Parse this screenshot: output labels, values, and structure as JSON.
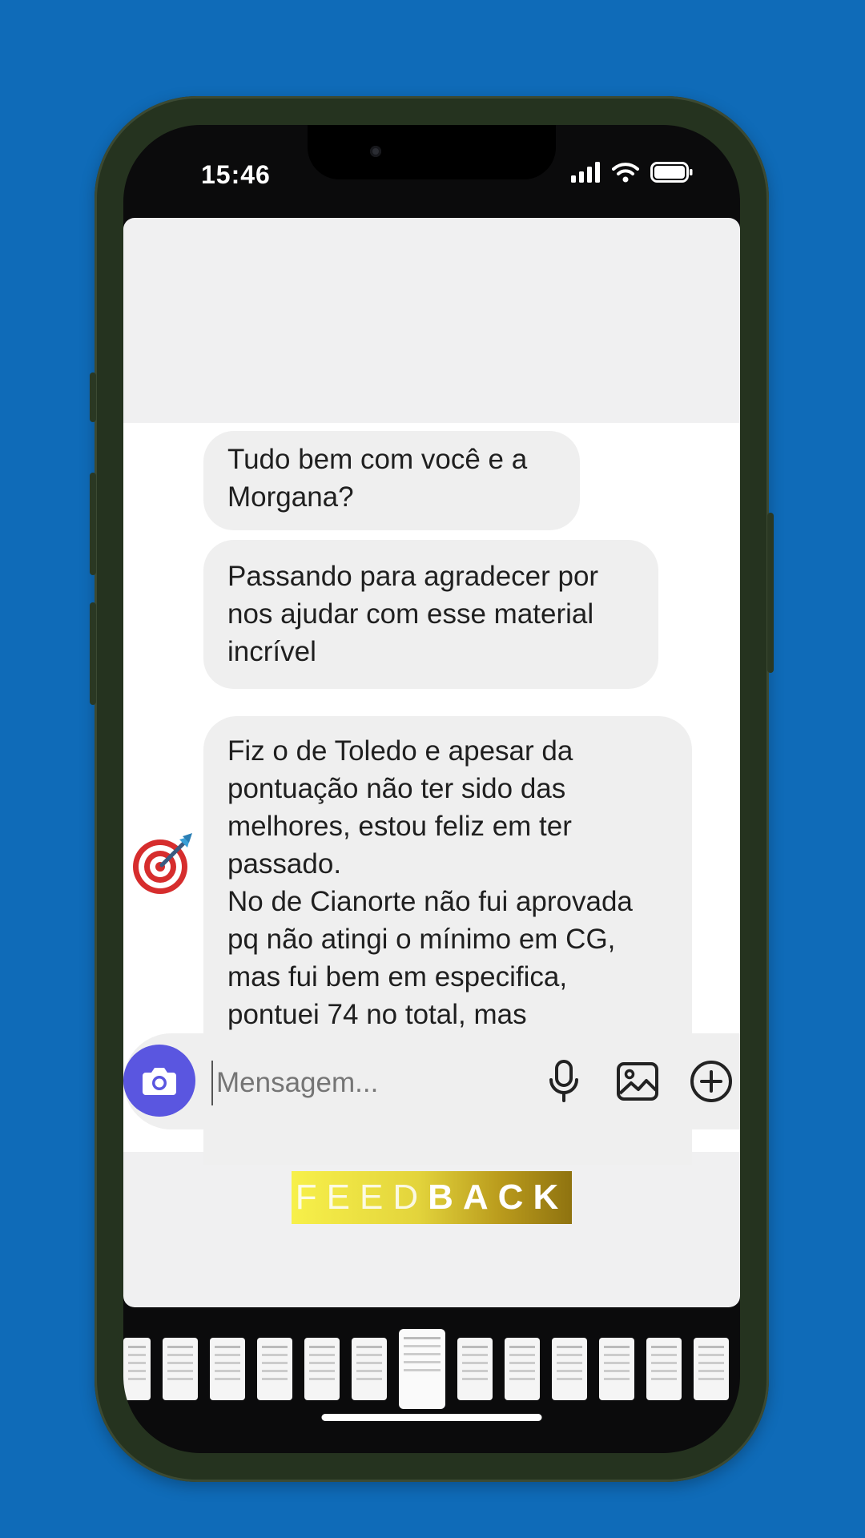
{
  "status_bar": {
    "time": "15:46"
  },
  "messages": [
    {
      "text": "Tudo bem com você e a\nMorgana?"
    },
    {
      "text": "Passando para agradecer por\nnos ajudar com esse material\nincrível"
    },
    {
      "text": "Fiz o de Toledo e apesar da\npontuação não ter sido das\nmelhores, estou feliz em ter\npassado.\nNo de Cianorte não fui aprovada\npq não atingi o mínimo em CG,\nmas fui bem em especifica,\npontuei 74 no total, mas"
    }
  ],
  "composer": {
    "placeholder": "Mensagem..."
  },
  "banner": {
    "part1": "FEED",
    "part2": "BACK"
  },
  "icons": {
    "camera": "camera-icon",
    "mic": "microphone-icon",
    "gallery": "image-icon",
    "add": "plus-circle-icon",
    "avatar": "target-dart-icon"
  },
  "colors": {
    "background": "#0f6bb8",
    "camera_button": "#5a56e0",
    "bubble": "#efefef"
  }
}
